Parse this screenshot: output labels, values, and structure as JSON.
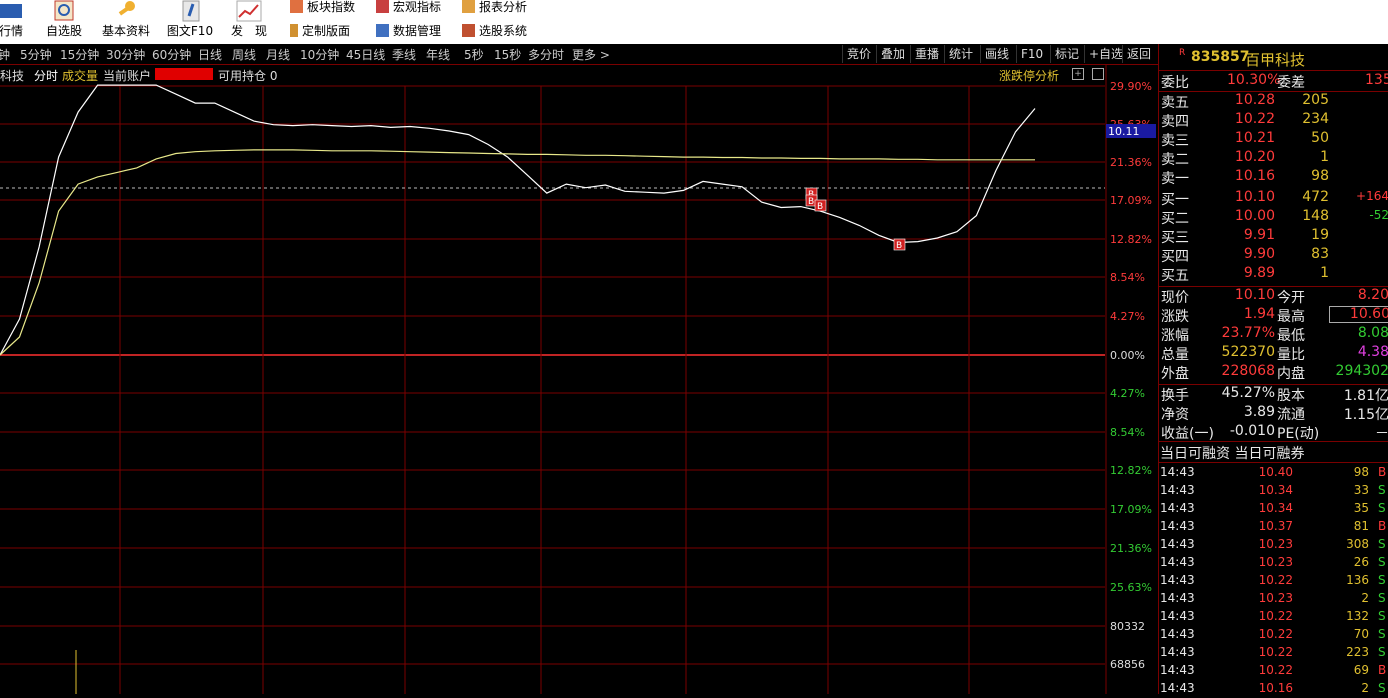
{
  "toolbar": {
    "big_buttons": [
      {
        "label": "行情",
        "icon": "quote-icon"
      },
      {
        "label": "自选股",
        "icon": "watchlist-icon"
      },
      {
        "label": "基本资料",
        "icon": "key-icon"
      },
      {
        "label": "图文F10",
        "icon": "doc-icon"
      },
      {
        "label": "发　现",
        "icon": "discover-chart-icon"
      }
    ],
    "small_buttons": [
      {
        "label": "板块指数",
        "icon": "sector-index-icon"
      },
      {
        "label": "定制版面",
        "icon": "layout-icon"
      },
      {
        "label": "宏观指标",
        "icon": "macro-icon"
      },
      {
        "label": "数据管理",
        "icon": "data-manage-icon"
      },
      {
        "label": "报表分析",
        "icon": "report-icon"
      },
      {
        "label": "选股系统",
        "icon": "stock-picker-icon"
      }
    ]
  },
  "periods": [
    "钟",
    "5分钟",
    "15分钟",
    "30分钟",
    "60分钟",
    "日线",
    "周线",
    "月线",
    "10分钟",
    "45日线",
    "季线",
    "年线",
    "5秒",
    "15秒",
    "多分时",
    "更多 >"
  ],
  "right_buttons": [
    "竞价",
    "叠加",
    "重播",
    "统计",
    "画线",
    "F10",
    "标记",
    "+自选",
    "返回"
  ],
  "infobar": {
    "name_tail": "科技",
    "mode": "分时",
    "volume_label": "成交量",
    "account_label": "当前账户",
    "position_label": "可用持仓 0",
    "limit_analysis": "涨跌停分析"
  },
  "axis": {
    "price_flag": "10.11",
    "right_labels": [
      "29.90%",
      "25.63%",
      "21.36%",
      "17.09%",
      "12.82%",
      "8.54%",
      "4.27%",
      "0.00%",
      "4.27%",
      "8.54%",
      "12.82%",
      "17.09%",
      "21.36%",
      "25.63%",
      "80332",
      "68856"
    ]
  },
  "chart_data": {
    "type": "line",
    "title": "",
    "y_unit": "percent change",
    "ylim": [
      -29.9,
      29.9
    ],
    "series": [
      {
        "name": "",
        "color": "#ffffff",
        "values": [
          0,
          4,
          12,
          22,
          27,
          30,
          30,
          30,
          30,
          29,
          28,
          28,
          27,
          26,
          25.6,
          25.5,
          25.6,
          25.5,
          25.4,
          25.5,
          25.3,
          25.4,
          25.2,
          24.9,
          24.5,
          23.4,
          22,
          20,
          18,
          19,
          18.6,
          18.9,
          18.2,
          18.1,
          18,
          18.3,
          19.3,
          19,
          18.7,
          17,
          16.4,
          16.5,
          16.0,
          15.3,
          14.4,
          13.3,
          12.5,
          12.6,
          13,
          13.7,
          15.5,
          20.5,
          24.8,
          27.4
        ]
      },
      {
        "name": "",
        "color": "#e8e88a",
        "values": [
          0,
          2,
          8,
          16,
          19,
          19.8,
          20.3,
          20.8,
          21.8,
          22.4,
          22.6,
          22.7,
          22.75,
          22.8,
          22.8,
          22.8,
          22.75,
          22.7,
          22.7,
          22.7,
          22.65,
          22.6,
          22.55,
          22.5,
          22.45,
          22.4,
          22.35,
          22.3,
          22.3,
          22.25,
          22.2,
          22.2,
          22.15,
          22.1,
          22.05,
          22,
          22,
          21.95,
          21.95,
          21.9,
          21.9,
          21.85,
          21.85,
          21.8,
          21.8,
          21.8,
          21.75,
          21.75,
          21.7,
          21.7,
          21.7,
          21.7,
          21.7,
          21.7
        ]
      }
    ],
    "markers": [
      "B",
      "B",
      "B",
      "B"
    ]
  },
  "quote": {
    "code": "835857",
    "name": "百甲科技",
    "webi_label": "委比",
    "webi": "10.30%",
    "weicha_label": "委差",
    "weicha": "135",
    "sells": [
      {
        "label": "卖五",
        "price": "10.28",
        "vol": "205"
      },
      {
        "label": "卖四",
        "price": "10.22",
        "vol": "234"
      },
      {
        "label": "卖三",
        "price": "10.21",
        "vol": "50"
      },
      {
        "label": "卖二",
        "price": "10.20",
        "vol": "1"
      },
      {
        "label": "卖一",
        "price": "10.16",
        "vol": "98"
      }
    ],
    "buys": [
      {
        "label": "买一",
        "price": "10.10",
        "vol": "472",
        "chg": "+164"
      },
      {
        "label": "买二",
        "price": "10.00",
        "vol": "148",
        "chg": "-52"
      },
      {
        "label": "买三",
        "price": "9.91",
        "vol": "19",
        "chg": ""
      },
      {
        "label": "买四",
        "price": "9.90",
        "vol": "83",
        "chg": ""
      },
      {
        "label": "买五",
        "price": "9.89",
        "vol": "1",
        "chg": ""
      }
    ],
    "stats": [
      {
        "l1": "现价",
        "v1": "10.10",
        "c1": "red",
        "l2": "今开",
        "v2": "8.20",
        "c2": "red"
      },
      {
        "l1": "涨跌",
        "v1": "1.94",
        "c1": "red",
        "l2": "最高",
        "v2": "10.60",
        "c2": "red"
      },
      {
        "l1": "涨幅",
        "v1": "23.77%",
        "c1": "red",
        "l2": "最低",
        "v2": "8.08",
        "c2": "grn"
      },
      {
        "l1": "总量",
        "v1": "522370",
        "c1": "yel",
        "l2": "量比",
        "v2": "4.38",
        "c2": "mag"
      },
      {
        "l1": "外盘",
        "v1": "228068",
        "c1": "red",
        "l2": "内盘",
        "v2": "294302",
        "c2": "grn"
      }
    ],
    "stats2": [
      {
        "l1": "换手",
        "v1": "45.27%",
        "l2": "股本",
        "v2": "1.81亿"
      },
      {
        "l1": "净资",
        "v1": "3.89",
        "l2": "流通",
        "v2": "1.15亿"
      },
      {
        "l1": "收益(一)",
        "v1": "-0.010",
        "l2": "PE(动)",
        "v2": "－"
      }
    ],
    "margin_label": "当日可融资 当日可融券",
    "ticks": [
      {
        "time": "14:43",
        "price": "10.40",
        "vol": "98",
        "side": "B"
      },
      {
        "time": "14:43",
        "price": "10.34",
        "vol": "33",
        "side": "S"
      },
      {
        "time": "14:43",
        "price": "10.34",
        "vol": "35",
        "side": "S"
      },
      {
        "time": "14:43",
        "price": "10.37",
        "vol": "81",
        "side": "B"
      },
      {
        "time": "14:43",
        "price": "10.23",
        "vol": "308",
        "side": "S"
      },
      {
        "time": "14:43",
        "price": "10.23",
        "vol": "26",
        "side": "S"
      },
      {
        "time": "14:43",
        "price": "10.22",
        "vol": "136",
        "side": "S"
      },
      {
        "time": "14:43",
        "price": "10.23",
        "vol": "2",
        "side": "S"
      },
      {
        "time": "14:43",
        "price": "10.22",
        "vol": "132",
        "side": "S"
      },
      {
        "time": "14:43",
        "price": "10.22",
        "vol": "70",
        "side": "S"
      },
      {
        "time": "14:43",
        "price": "10.22",
        "vol": "223",
        "side": "S"
      },
      {
        "time": "14:43",
        "price": "10.22",
        "vol": "69",
        "side": "B"
      },
      {
        "time": "14:43",
        "price": "10.16",
        "vol": "2",
        "side": "S"
      }
    ]
  }
}
